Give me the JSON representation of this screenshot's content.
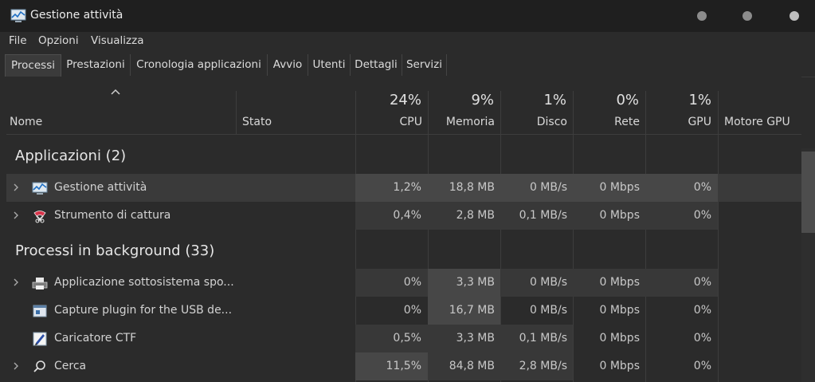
{
  "window": {
    "title": "Gestione attività"
  },
  "menu": [
    "File",
    "Opzioni",
    "Visualizza"
  ],
  "tabs": [
    "Processi",
    "Prestazioni",
    "Cronologia applicazioni",
    "Avvio",
    "Utenti",
    "Dettagli",
    "Servizi"
  ],
  "active_tab": "Processi",
  "columns": {
    "name": "Nome",
    "status": "Stato",
    "cpu": {
      "pct": "24%",
      "label": "CPU"
    },
    "memory": {
      "pct": "9%",
      "label": "Memoria"
    },
    "disk": {
      "pct": "1%",
      "label": "Disco"
    },
    "network": {
      "pct": "0%",
      "label": "Rete"
    },
    "gpu": {
      "pct": "1%",
      "label": "GPU"
    },
    "gpu_engine": "Motore GPU"
  },
  "groups": [
    {
      "label": "Applicazioni (2)",
      "rows": [
        {
          "name": "Gestione attività",
          "icon": "task-manager-icon",
          "expandable": true,
          "cpu": "1,2%",
          "memory": "18,8 MB",
          "disk": "0 MB/s",
          "network": "0 Mbps",
          "gpu": "0%"
        },
        {
          "name": "Strumento di cattura",
          "icon": "snipping-tool-icon",
          "expandable": true,
          "cpu": "0,4%",
          "memory": "2,8 MB",
          "disk": "0,1 MB/s",
          "network": "0 Mbps",
          "gpu": "0%"
        }
      ]
    },
    {
      "label": "Processi in background (33)",
      "rows": [
        {
          "name": "Applicazione sottosistema spo...",
          "icon": "printer-icon",
          "expandable": true,
          "cpu": "0%",
          "memory": "3,3 MB",
          "disk": "0 MB/s",
          "network": "0 Mbps",
          "gpu": "0%"
        },
        {
          "name": "Capture plugin for the USB de...",
          "icon": "capture-plugin-icon",
          "expandable": false,
          "cpu": "0%",
          "memory": "16,7 MB",
          "disk": "0 MB/s",
          "network": "0 Mbps",
          "gpu": "0%"
        },
        {
          "name": "Caricatore CTF",
          "icon": "ctf-loader-icon",
          "expandable": false,
          "cpu": "0,5%",
          "memory": "3,3 MB",
          "disk": "0,1 MB/s",
          "network": "0 Mbps",
          "gpu": "0%"
        },
        {
          "name": "Cerca",
          "icon": "search-icon",
          "expandable": true,
          "cpu": "11,5%",
          "memory": "84,8 MB",
          "disk": "2,8 MB/s",
          "network": "0 Mbps",
          "gpu": "0%"
        }
      ]
    }
  ]
}
